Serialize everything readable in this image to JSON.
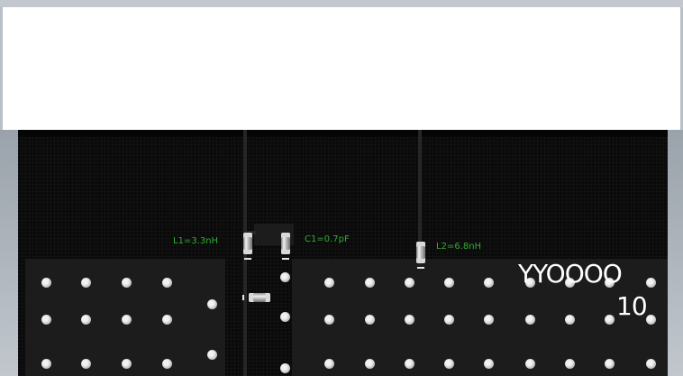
{
  "components": {
    "l1": "L1=3.3nH",
    "c1": "C1=0.7pF",
    "l2": "L2=6.8nH"
  },
  "silkscreen": {
    "line1": "YYOOOO",
    "line2": "10"
  },
  "colors": {
    "board": "#0a0a0a",
    "label": "#2fae2f",
    "silkscreen": "#ffffff",
    "panel": "#ffffff"
  }
}
